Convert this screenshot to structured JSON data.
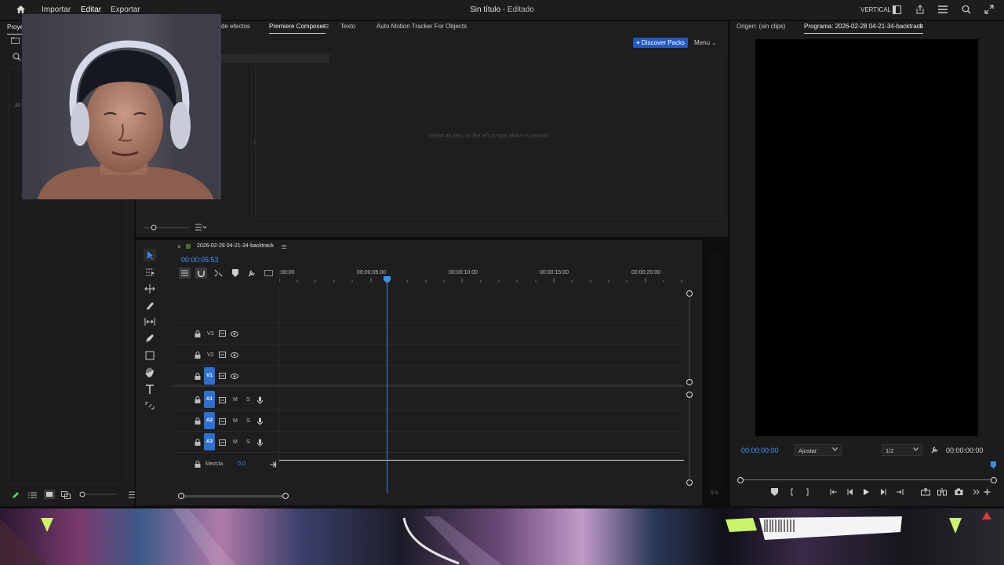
{
  "menu": {
    "items": [
      "Importar",
      "Editar",
      "Exportar"
    ],
    "active": "Editar"
  },
  "title": {
    "main": "Sin título",
    "sub": "- Editado"
  },
  "workspace": {
    "label": "VERTICAL"
  },
  "left_panel": {
    "tab_partial": "Proye",
    "item_partial": "20"
  },
  "effects_panel": {
    "tabs": [
      "de efectos",
      "Premiere Composer",
      "Texto",
      "Auto Motion Tracker For Objects"
    ],
    "active_tab": "Premiere Composer",
    "discover_label": "Discover Packs",
    "menu_label": "Menu",
    "empty_hint": "Select an item on the left or type above to search."
  },
  "timeline": {
    "sequence_name": "2026-02-28 04-21-34-backtrack",
    "timecode": "00:00:05:53",
    "ruler": [
      ":00:00",
      "00:00:05:00",
      "00:00:10:00",
      "00:00:15:00",
      "00:00:20:00"
    ],
    "tracks_video": [
      "V3",
      "V2",
      "V1"
    ],
    "tracks_audio": [
      "A1",
      "A2",
      "A3"
    ],
    "mix_label": "Mezcla",
    "mix_value": "0.0",
    "audio_m": "M",
    "audio_s": "S",
    "meter_label": "S S"
  },
  "program_monitor": {
    "source_tab": "Origen: (sin clips)",
    "program_tab": "Programa: 2026-02-28 04-21-34-backtrack",
    "timecode": "00:00:00:00",
    "fit_label": "Ajustar",
    "resolution": "1/2",
    "duration": "00:00:00:00"
  },
  "colors": {
    "accent": "#2d8ceb",
    "target_blue": "#2d6fd2",
    "discover_blue": "#2159c7",
    "panel_bg": "#1e1e1e"
  }
}
